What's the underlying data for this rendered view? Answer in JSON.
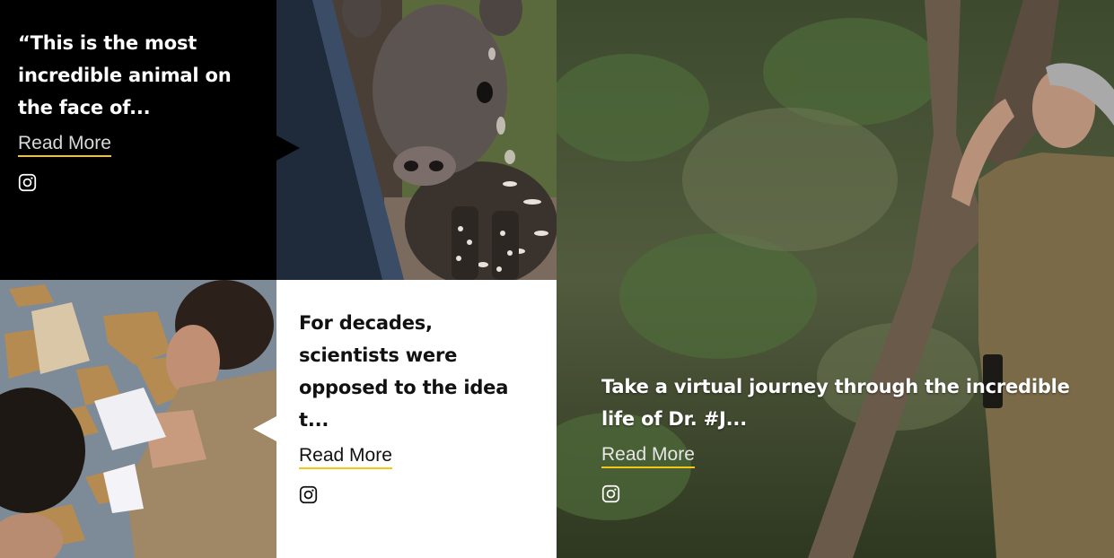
{
  "posts": [
    {
      "excerpt": "“This is the most incredible animal on the face of...",
      "read_more": "Read More",
      "icon": "instagram-icon"
    },
    {
      "excerpt": "For decades, scientists were opposed to the idea t...",
      "read_more": "Read More",
      "icon": "instagram-icon"
    },
    {
      "excerpt": "Take a virtual journey through the incredible life of Dr. #J...",
      "read_more": "Read More",
      "icon": "instagram-icon"
    }
  ],
  "colors": {
    "accent_underline": "#f5c518",
    "dark_card": "#000000",
    "light_card": "#ffffff"
  }
}
